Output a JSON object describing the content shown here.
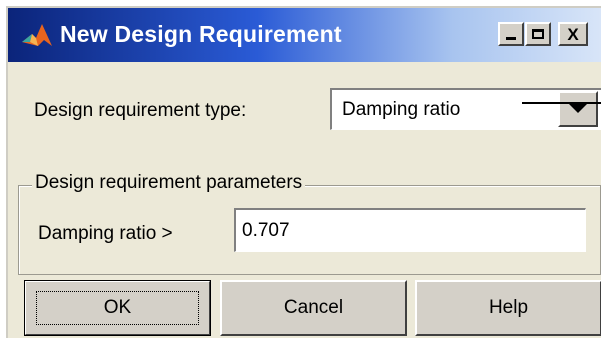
{
  "window": {
    "title": "New Design Requirement",
    "controls": {
      "minimize": "_",
      "maximize": "□",
      "close": "X"
    },
    "app_icon": "matlab-logo-icon"
  },
  "requirement_type": {
    "label": "Design requirement type:",
    "selected": "Damping ratio"
  },
  "parameters": {
    "group_title": "Design requirement parameters",
    "damping_label": "Damping ratio  >",
    "damping_value": "0.707"
  },
  "buttons": {
    "ok": "OK",
    "cancel": "Cancel",
    "help": "Help"
  }
}
